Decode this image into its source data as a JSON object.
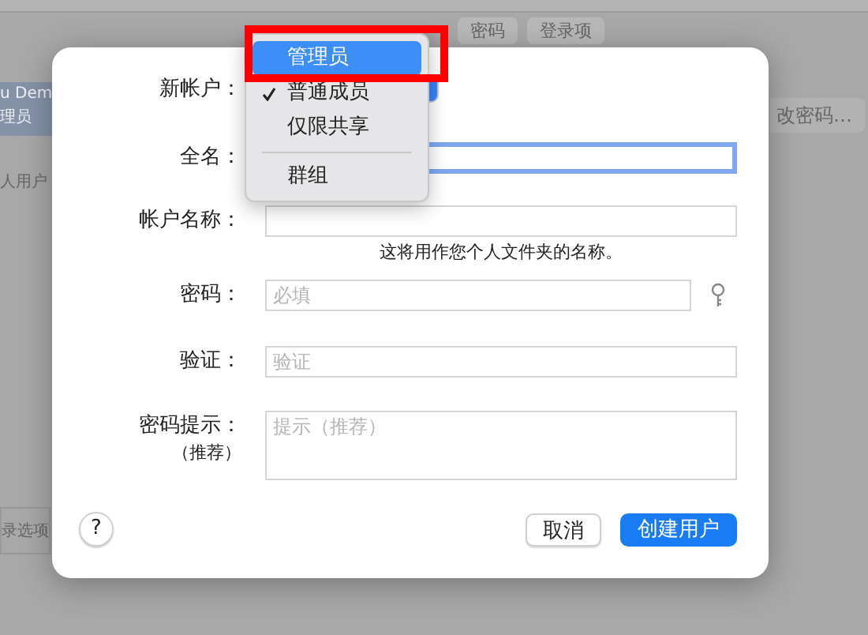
{
  "background": {
    "tabs": [
      "密码",
      "登录项"
    ],
    "sidebar_user": "u Dem",
    "sidebar_role": "理员",
    "sidebar_other": "人用户",
    "change_password": "改密码…",
    "login_options": "录选项"
  },
  "dialog": {
    "fields": [
      {
        "label": "新帐户：",
        "kind": "popup"
      },
      {
        "label": "全名：",
        "kind": "text",
        "focused": true
      },
      {
        "label": "帐户名称：",
        "kind": "text",
        "focused": false,
        "note": "这将用作您个人文件夹的名称。"
      },
      {
        "label": "密码：",
        "kind": "password",
        "placeholder": "必填"
      },
      {
        "label": "验证：",
        "kind": "text",
        "focused": false,
        "placeholder": "验证"
      },
      {
        "label": "密码提示：",
        "sublabel": "（推荐）",
        "kind": "textarea",
        "placeholder": "提示（推荐）"
      }
    ],
    "help": "?",
    "buttons": [
      {
        "label": "取消",
        "default": false
      },
      {
        "label": "创建用户",
        "default": true
      }
    ]
  },
  "menu": {
    "items": [
      {
        "label": "管理员",
        "selected": true,
        "checked": false,
        "separator_before": false
      },
      {
        "label": "普通成员",
        "selected": false,
        "checked": true,
        "separator_before": false
      },
      {
        "label": "仅限共享",
        "selected": false,
        "checked": false,
        "separator_before": false
      },
      {
        "label": "群组",
        "selected": false,
        "checked": false,
        "separator_before": true
      }
    ]
  },
  "highlight_frame": true
}
